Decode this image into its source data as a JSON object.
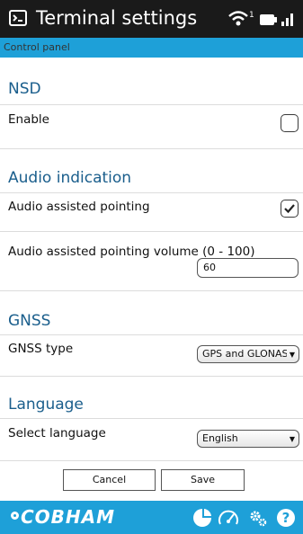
{
  "header": {
    "title": "Terminal settings",
    "signal_superscript": "1"
  },
  "breadcrumb": "Control panel",
  "nsd": {
    "title": "NSD",
    "enable_label": "Enable",
    "enable_checked": false
  },
  "audio": {
    "title": "Audio indication",
    "assisted_label": "Audio assisted pointing",
    "assisted_checked": true,
    "volume_label": "Audio assisted pointing volume (0 - 100)",
    "volume_value": "60"
  },
  "gnss": {
    "title": "GNSS",
    "type_label": "GNSS type",
    "type_value": "GPS and GLONASS"
  },
  "language": {
    "title": "Language",
    "select_label": "Select language",
    "select_value": "English"
  },
  "buttons": {
    "cancel": "Cancel",
    "save": "Save"
  },
  "footer": {
    "logo": "COBHAM"
  },
  "colors": {
    "header_bg": "#1a1a1a",
    "accent": "#1ea0d8",
    "section_title": "#1a5e8c"
  },
  "icons": [
    "terminal-icon",
    "wifi-icon",
    "battery-icon",
    "signal-bars-icon",
    "pie-chart-icon",
    "gauge-icon",
    "settings-icon",
    "help-icon"
  ]
}
